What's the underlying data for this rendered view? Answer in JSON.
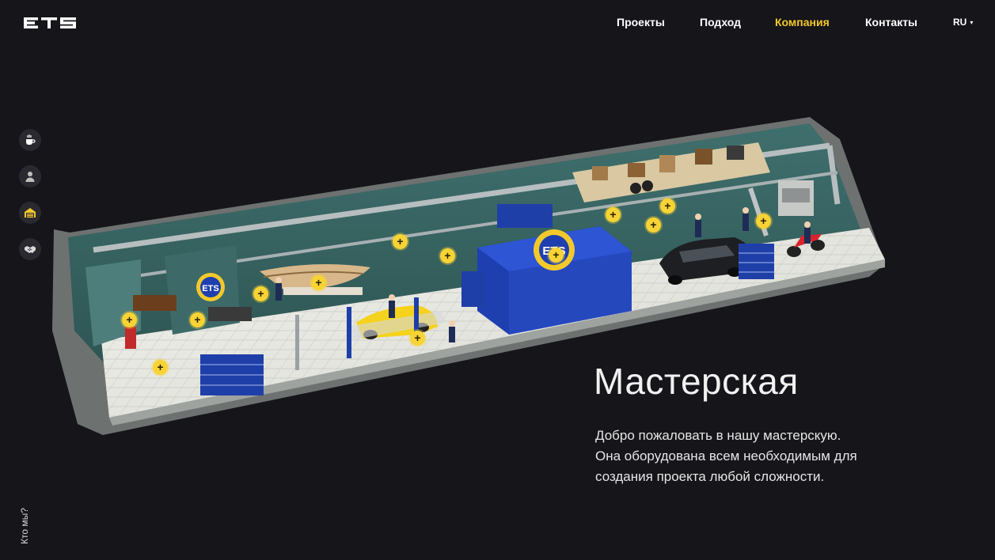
{
  "brand": {
    "logo_text": "ETS"
  },
  "nav": {
    "items": [
      {
        "label": "Проекты",
        "active": false
      },
      {
        "label": "Подход",
        "active": false
      },
      {
        "label": "Компания",
        "active": true
      },
      {
        "label": "Контакты",
        "active": false
      }
    ],
    "language": "RU"
  },
  "sidebar": {
    "icons": [
      "coffee-icon",
      "person-icon",
      "garage-icon",
      "handshake-icon"
    ],
    "active_index": 2,
    "vertical_label": "Кто мы?"
  },
  "hero": {
    "title": "Мастерская",
    "description": [
      "Добро пожаловать в нашу мастерскую.",
      "Она оборудована всем необходимым для",
      "создания проекта любой сложности."
    ]
  },
  "scene": {
    "sign_text": "ETS",
    "hotspot_symbol": "+",
    "hotspot_count": 13
  },
  "colors": {
    "background": "#16151a",
    "accent": "#f2c92b",
    "wall": "#3d6a68",
    "floor": "#e9ebe4",
    "container": "#1e3fb0"
  }
}
